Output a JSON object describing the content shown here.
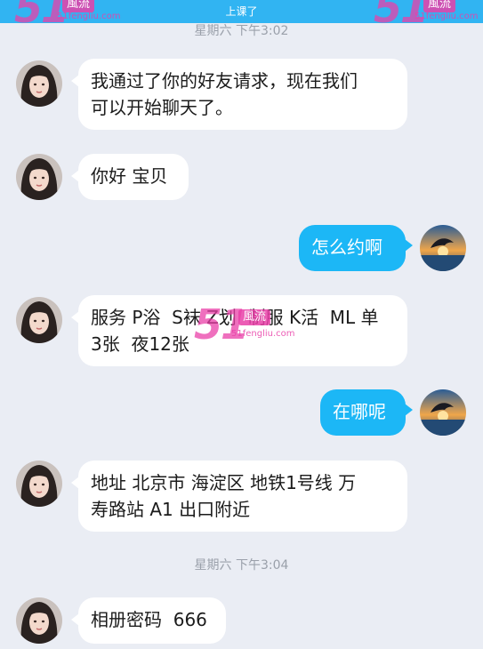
{
  "header": {
    "title": "上课了",
    "watermark": {
      "number": "51",
      "badge": "風流",
      "site": "51fengliu.com"
    }
  },
  "timestamps": [
    "星期六 下午3:02",
    "星期六 下午3:04"
  ],
  "messages": [
    {
      "side": "left",
      "text": "我通过了你的好友请求，现在我们\n可以开始聊天了。"
    },
    {
      "side": "left",
      "text": "你好 宝贝"
    },
    {
      "side": "right",
      "text": "怎么约啊"
    },
    {
      "side": "left",
      "text": "服务 P浴  S袜 Z划  制服 K活  ML 单\n3张  夜12张"
    },
    {
      "side": "right",
      "text": "在哪呢"
    },
    {
      "side": "left",
      "text": "地址 北京市 海淀区 地铁1号线 万\n寿路站 A1 出口附近"
    },
    {
      "side": "left",
      "text": "相册密码  666"
    }
  ],
  "colors": {
    "background": "#eaedf4",
    "topbar": "#31b4f2",
    "sent_bubble": "#1cb7f6",
    "received_bubble": "#ffffff",
    "watermark": "#e940a8"
  },
  "icons": {
    "contact_avatar": "woman-portrait-avatar",
    "self_avatar": "dolphin-sunset-avatar"
  }
}
